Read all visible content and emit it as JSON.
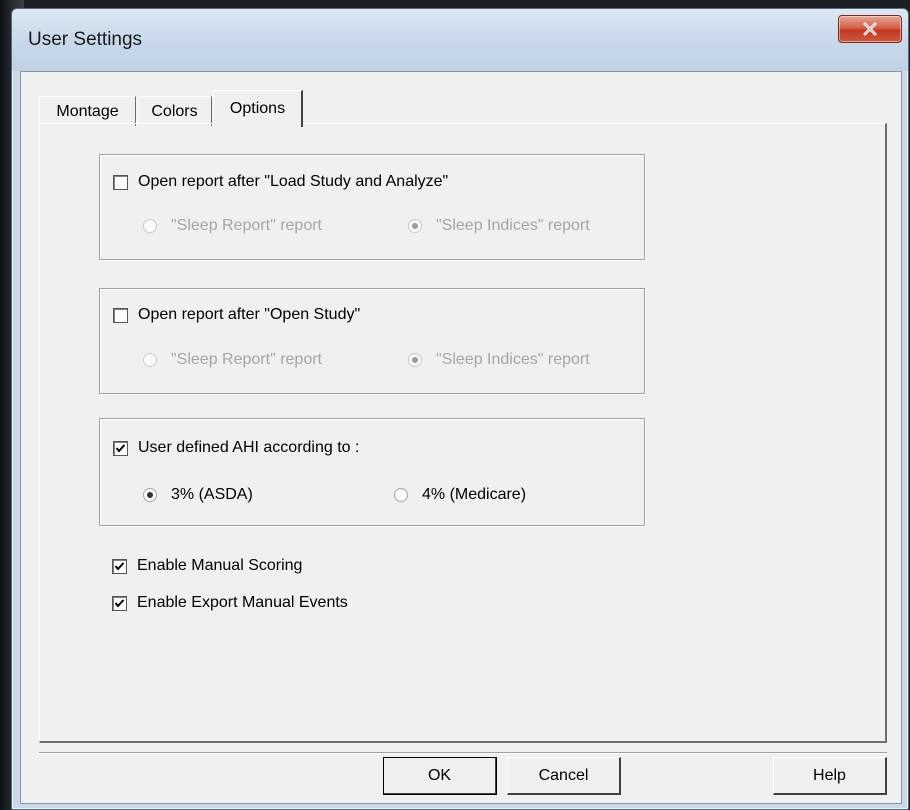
{
  "window": {
    "title": "User Settings",
    "close_icon": "close-icon"
  },
  "tabs": [
    {
      "label": "Montage",
      "active": false
    },
    {
      "label": "Colors",
      "active": false
    },
    {
      "label": "Options",
      "active": true
    }
  ],
  "groups": {
    "load_study": {
      "checkbox_label": "Open report after  \"Load Study and Analyze\"",
      "checked": false,
      "radios": [
        {
          "label": "\"Sleep Report\" report",
          "selected": false,
          "enabled": false
        },
        {
          "label": "\"Sleep Indices\" report",
          "selected": true,
          "enabled": false
        }
      ]
    },
    "open_study": {
      "checkbox_label": "Open report after  \"Open Study\"",
      "checked": false,
      "radios": [
        {
          "label": "\"Sleep Report\" report",
          "selected": false,
          "enabled": false
        },
        {
          "label": "\"Sleep Indices\" report",
          "selected": true,
          "enabled": false
        }
      ]
    },
    "ahi": {
      "checkbox_label": "User defined AHI according to :",
      "checked": true,
      "radios": [
        {
          "label": "3% (ASDA)",
          "selected": true,
          "enabled": true
        },
        {
          "label": "4% (Medicare)",
          "selected": false,
          "enabled": true
        }
      ]
    }
  },
  "options": {
    "manual_scoring": {
      "label": "Enable Manual Scoring",
      "checked": true
    },
    "export_manual_events": {
      "label": "Enable Export Manual Events",
      "checked": true
    }
  },
  "buttons": {
    "ok": "OK",
    "cancel": "Cancel",
    "help": "Help"
  },
  "colors": {
    "titlebar": "#c7d8ea",
    "close_button": "#c1391f",
    "dialog_face": "#f0f0f0",
    "disabled_text": "#a5a5a5"
  }
}
